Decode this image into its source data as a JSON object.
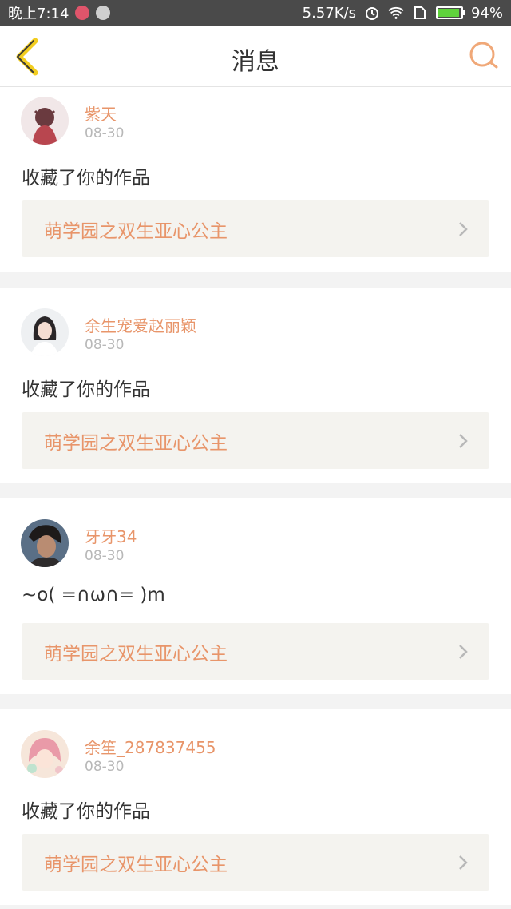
{
  "status_bar": {
    "time": "晚上7:14",
    "network_speed": "5.57K/s",
    "battery": "94%",
    "battery_level": 0.94
  },
  "header": {
    "title": "消息",
    "back_icon": "chevron-left-icon",
    "search_icon": "search-icon"
  },
  "colors": {
    "accent": "#e8956a",
    "back_icon": "#f2cd20",
    "search_icon": "#f0a878"
  },
  "messages": [
    {
      "name": "紫天",
      "date": "08-30",
      "text": "收藏了你的作品",
      "work_title": "萌学园之双生亚心公主"
    },
    {
      "name": "余生宠爱赵丽颖",
      "date": "08-30",
      "text": "收藏了你的作品",
      "work_title": "萌学园之双生亚心公主"
    },
    {
      "name": "牙牙34",
      "date": "08-30",
      "text": "~o( =∩ω∩= )m",
      "work_title": "萌学园之双生亚心公主"
    },
    {
      "name": "余笙_287837455",
      "date": "08-30",
      "text": "收藏了你的作品",
      "work_title": "萌学园之双生亚心公主"
    }
  ]
}
